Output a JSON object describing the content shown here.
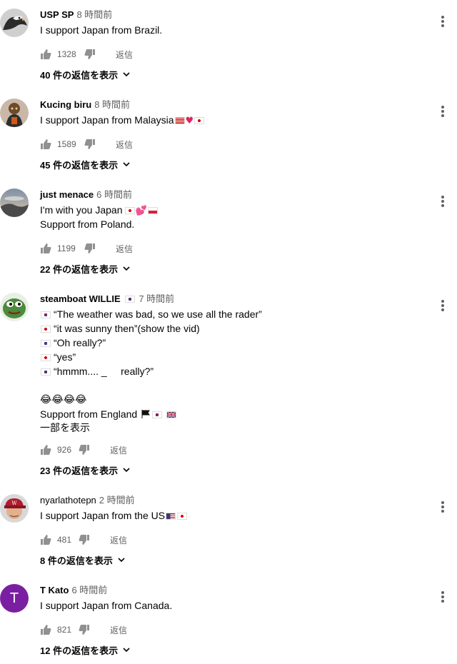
{
  "comments": [
    {
      "author": "USP SP",
      "time": "8 時間前",
      "lines": [
        "I support Japan from Brazil."
      ],
      "likes": "1328",
      "reply_label": "返信",
      "replies_label": "40 件の返信を表示",
      "avatar_icon": "eagle-avatar"
    },
    {
      "author": "Kucing biru",
      "time": "8 時間前",
      "lines": [
        "I support Japan from Malaysia"
      ],
      "line_suffix": [
        "flag-malaysia",
        "red-heart",
        "flag-japan"
      ],
      "likes": "1589",
      "reply_label": "返信",
      "replies_label": "45 件の返信を表示",
      "avatar_icon": "character-avatar"
    },
    {
      "author": "just menace",
      "time": "6 時間前",
      "lines": [
        "I'm with you Japan",
        "Support from Poland."
      ],
      "line_suffix": [
        "flag-japan",
        "two-hearts",
        "flag-poland"
      ],
      "likes": "1199",
      "reply_label": "返信",
      "replies_label": "22 件の返信を表示",
      "avatar_icon": "landscape-avatar"
    },
    {
      "author": "steamboat WILLIE",
      "time": "7 時間前",
      "lines": [
        "“The weather was bad, so we use all the rader”",
        "“it was sunny then”(show the vid)",
        "“Oh really?”",
        "“yes”",
        "“hmmm.... _     really?”",
        "",
        "😂😂😂😂",
        "Support from England"
      ],
      "line_prefix": [
        "flag-korea",
        "flag-japan",
        "flag-korea",
        "flag-japan",
        "flag-korea"
      ],
      "show_more": "一部を表示",
      "likes": "926",
      "reply_label": "返信",
      "replies_label": "23 件の返信を表示",
      "avatar_icon": "pepe-avatar"
    },
    {
      "author": "nyarlathotepn",
      "time": "2 時間前",
      "lines": [
        "I support Japan from the US"
      ],
      "line_suffix": [
        "flag-usa",
        "flag-japan"
      ],
      "likes": "481",
      "reply_label": "返信",
      "replies_label": "8 件の返信を表示",
      "avatar_icon": "player-avatar"
    },
    {
      "author": "T Kato",
      "time": "6 時間前",
      "lines": [
        "I support Japan from Canada."
      ],
      "likes": "821",
      "reply_label": "返信",
      "replies_label": "12 件の返信を表示",
      "avatar_letter": "T",
      "avatar_color": "#7b1fa2"
    }
  ],
  "icons": {
    "like": "thumbs-up-icon",
    "dislike": "thumbs-down-icon",
    "menu": "more-vert-icon",
    "expand": "chevron-down-icon"
  }
}
